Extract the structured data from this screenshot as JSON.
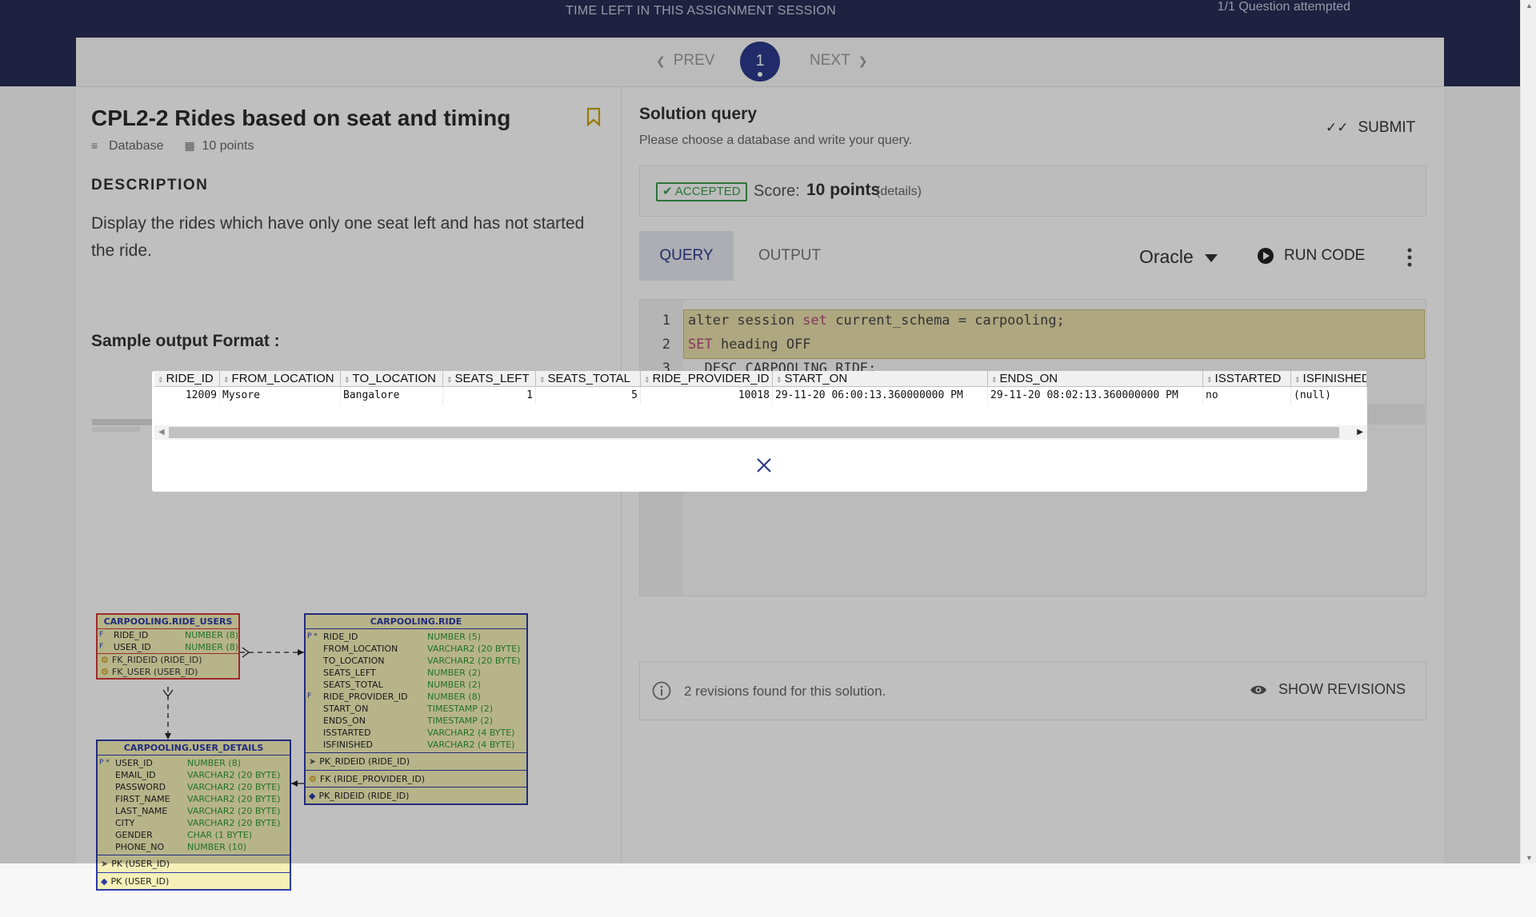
{
  "topbar": {
    "session_text": "TIME LEFT IN THIS ASSIGNMENT SESSION",
    "attempted_text": "1/1 Question attempted"
  },
  "qnav": {
    "prev": "PREV",
    "next": "NEXT",
    "current": "1"
  },
  "question": {
    "title": "CPL2-2 Rides based on seat and timing",
    "type": "Database",
    "points": "10 points",
    "description_heading": "DESCRIPTION",
    "description": "Display the rides which have only one seat left and has not started the ride.",
    "sample_heading": "Sample output Format :"
  },
  "erd": {
    "ride_users": {
      "title": "CARPOOLING.RIDE_USERS",
      "columns": [
        {
          "flag": "F",
          "name": "RIDE_ID",
          "type": "NUMBER (8)"
        },
        {
          "flag": "F",
          "name": "USER_ID",
          "type": "NUMBER (8)"
        }
      ],
      "keys": [
        "FK_RIDEID (RIDE_ID)",
        "FK_USER (USER_ID)"
      ]
    },
    "ride": {
      "title": "CARPOOLING.RIDE",
      "columns": [
        {
          "flag": "P *",
          "name": "RIDE_ID",
          "type": "NUMBER (5)"
        },
        {
          "flag": "",
          "name": "FROM_LOCATION",
          "type": "VARCHAR2 (20 BYTE)"
        },
        {
          "flag": "",
          "name": "TO_LOCATION",
          "type": "VARCHAR2 (20 BYTE)"
        },
        {
          "flag": "",
          "name": "SEATS_LEFT",
          "type": "NUMBER (2)"
        },
        {
          "flag": "",
          "name": "SEATS_TOTAL",
          "type": "NUMBER (2)"
        },
        {
          "flag": "F",
          "name": "RIDE_PROVIDER_ID",
          "type": "NUMBER (8)"
        },
        {
          "flag": "",
          "name": "START_ON",
          "type": "TIMESTAMP (2)"
        },
        {
          "flag": "",
          "name": "ENDS_ON",
          "type": "TIMESTAMP (2)"
        },
        {
          "flag": "",
          "name": "ISSTARTED",
          "type": "VARCHAR2 (4 BYTE)"
        },
        {
          "flag": "",
          "name": "ISFINISHED",
          "type": "VARCHAR2 (4 BYTE)"
        }
      ],
      "keys": [
        "PK_RIDEID (RIDE_ID)",
        "FK (RIDE_PROVIDER_ID)",
        "PK_RIDEID (RIDE_ID)"
      ]
    },
    "user_details": {
      "title": "CARPOOLING.USER_DETAILS",
      "columns": [
        {
          "flag": "P *",
          "name": "USER_ID",
          "type": "NUMBER (8)"
        },
        {
          "flag": "",
          "name": "EMAIL_ID",
          "type": "VARCHAR2 (20 BYTE)"
        },
        {
          "flag": "",
          "name": "PASSWORD",
          "type": "VARCHAR2 (20 BYTE)"
        },
        {
          "flag": "",
          "name": "FIRST_NAME",
          "type": "VARCHAR2 (20 BYTE)"
        },
        {
          "flag": "",
          "name": "LAST_NAME",
          "type": "VARCHAR2 (20 BYTE)"
        },
        {
          "flag": "",
          "name": "CITY",
          "type": "VARCHAR2 (20 BYTE)"
        },
        {
          "flag": "",
          "name": "GENDER",
          "type": "CHAR (1 BYTE)"
        },
        {
          "flag": "",
          "name": "PHONE_NO",
          "type": "NUMBER (10)"
        }
      ],
      "keys": [
        "PK (USER_ID)",
        "PK (USER_ID)"
      ]
    }
  },
  "solution": {
    "heading": "Solution query",
    "subheading": "Please choose a database and write your query.",
    "submit": "SUBMIT",
    "status": "ACCEPTED",
    "score_label": "Score:",
    "score_value": "10 points",
    "score_details": "(details)",
    "tab_query": "QUERY",
    "tab_output": "OUTPUT",
    "database": "Oracle",
    "run_code": "RUN CODE",
    "code_lines": [
      {
        "n": "1",
        "pre_kw": "alter session ",
        "kw": "set",
        "post": " current_schema = carpooling;"
      },
      {
        "n": "2",
        "pre_kw": "",
        "kw": "SET",
        "post": " heading OFF"
      },
      {
        "n": "3",
        "pre_kw": "",
        "kw": "",
        "post": "  DESC CARPOOLING_RIDE;"
      }
    ],
    "revisions_text": "2 revisions found for this solution.",
    "show_revisions": "SHOW REVISIONS"
  },
  "modal": {
    "headers": [
      "RIDE_ID",
      "FROM_LOCATION",
      "TO_LOCATION",
      "SEATS_LEFT",
      "SEATS_TOTAL",
      "RIDE_PROVIDER_ID",
      "START_ON",
      "ENDS_ON",
      "ISSTARTED",
      "ISFINISHED"
    ],
    "row": [
      "12009",
      "Mysore",
      "Bangalore",
      "1",
      "5",
      "10018",
      "29-11-20 06:00:13.360000000 PM",
      "29-11-20 08:02:13.360000000 PM",
      "no",
      "(null)"
    ]
  },
  "colors": {
    "topbar": "#2a2d56",
    "accent": "#2d3a8c",
    "accepted": "#3a9a4a",
    "code_highlight": "#e9dfab"
  }
}
